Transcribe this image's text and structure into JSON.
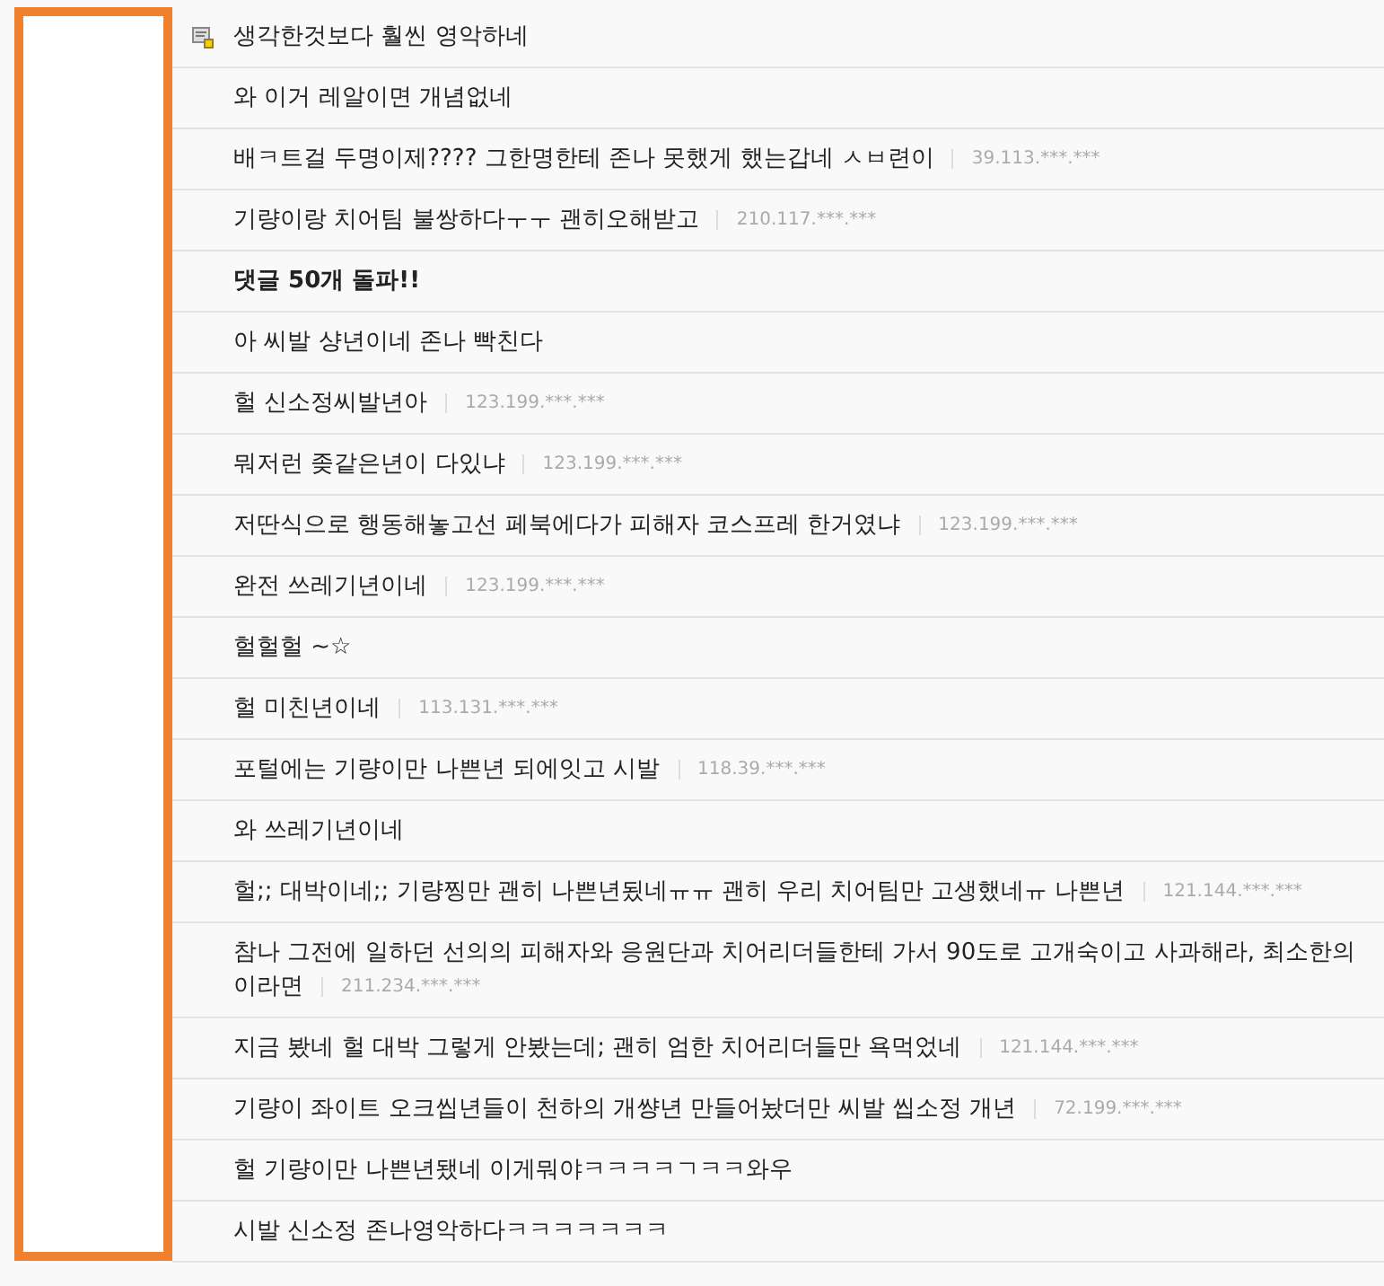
{
  "comments": [
    {
      "kind": "comment",
      "icon": true,
      "lines": [
        "생각한것보다 훨씬 영악하네"
      ]
    },
    {
      "kind": "comment",
      "icon": false,
      "lines": [
        "와 이거 레알이면 개념없네"
      ]
    },
    {
      "kind": "comment",
      "icon": false,
      "lines": [
        "배ㅋ트걸 두명이제???? 그한명한테 존나 못했게 했는갑네 ㅅㅂ련이"
      ],
      "ip": "39.113.***.***"
    },
    {
      "kind": "comment",
      "icon": false,
      "lines": [
        "기량이랑 치어팀 불쌍하다ㅜㅜ 괜히오해받고"
      ],
      "ip": "210.117.***.***"
    },
    {
      "kind": "milestone",
      "icon": false,
      "lines": [
        "댓글 50개 돌파!!"
      ]
    },
    {
      "kind": "comment",
      "icon": false,
      "lines": [
        "아 씨발 샹년이네 존나 빡친다"
      ]
    },
    {
      "kind": "comment",
      "icon": false,
      "lines": [
        "헐 신소정씨발년아"
      ],
      "ip": "123.199.***.***"
    },
    {
      "kind": "comment",
      "icon": false,
      "lines": [
        "뭐저런 좆같은년이 다있냐"
      ],
      "ip": "123.199.***.***"
    },
    {
      "kind": "comment",
      "icon": false,
      "lines": [
        "저딴식으로 행동해놓고선 페북에다가 피해자 코스프레 한거였냐"
      ],
      "ip": "123.199.***.***"
    },
    {
      "kind": "comment",
      "icon": false,
      "lines": [
        "완전 쓰레기년이네"
      ],
      "ip": "123.199.***.***"
    },
    {
      "kind": "comment",
      "icon": false,
      "lines": [
        "헐헐헐 ~☆"
      ]
    },
    {
      "kind": "comment",
      "icon": false,
      "lines": [
        "헐 미친년이네"
      ],
      "ip": "113.131.***.***"
    },
    {
      "kind": "comment",
      "icon": false,
      "lines": [
        "포털에는 기량이만 나쁜년 되에잇고 시발"
      ],
      "ip": "118.39.***.***"
    },
    {
      "kind": "comment",
      "icon": false,
      "lines": [
        "와 쓰레기년이네"
      ]
    },
    {
      "kind": "comment",
      "icon": false,
      "lines": [
        "헐;; 대박이네;; 기량찡만 괜히 나쁜년됬네ㅠㅠ 괜히 우리 치어팀만 고생했네ㅠ 나쁜년"
      ],
      "ip": "121.144.***.***"
    },
    {
      "kind": "comment",
      "icon": false,
      "lines": [
        "참나 그전에 일하던 선의의 피해자와 응원단과 치어리더들한테 가서 90도로 고개숙이고 사과해라, 최소한의",
        "이라면"
      ],
      "ip": "211.234.***.***"
    },
    {
      "kind": "comment",
      "icon": false,
      "lines": [
        "지금 봤네 헐 대박 그렇게 안봤는데; 괜히 엄한 치어리더들만 욕먹었네"
      ],
      "ip": "121.144.***.***"
    },
    {
      "kind": "comment",
      "icon": false,
      "lines": [
        "기량이 좌이트 오크씹년들이 천하의 개썅년 만들어놨더만 씨발 씹소정 개년"
      ],
      "ip": "72.199.***.***"
    },
    {
      "kind": "comment",
      "icon": false,
      "lines": [
        "헐 기량이만 나쁜년됐네 이게뭐야ㅋㅋㅋㅋㄱㅋㅋ와우"
      ]
    },
    {
      "kind": "comment",
      "icon": false,
      "lines": [
        "시발 신소정 존나영악하다ㅋㅋㅋㅋㅋㅋㅋ"
      ]
    }
  ]
}
